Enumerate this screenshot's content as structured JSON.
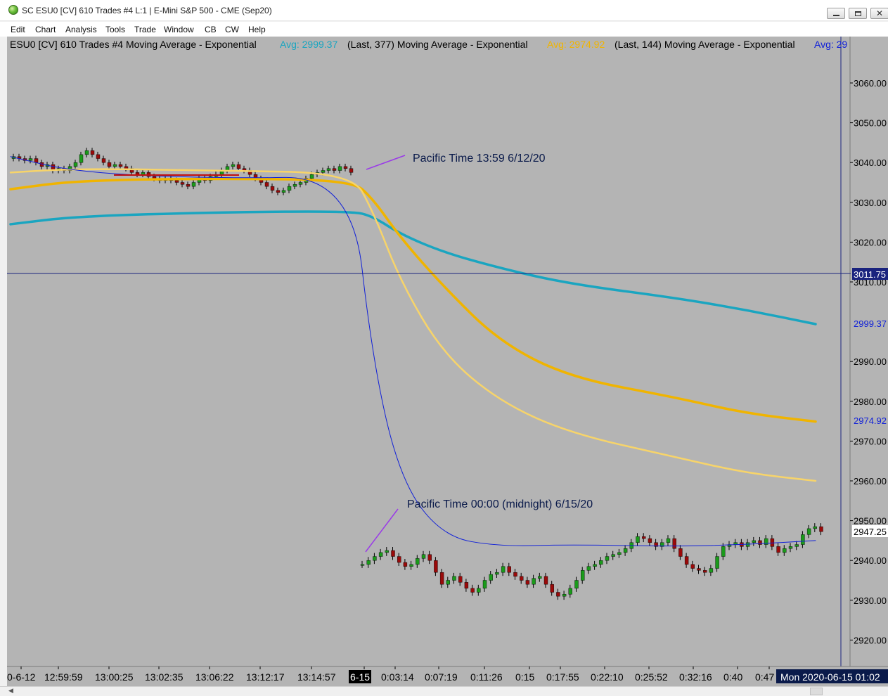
{
  "window": {
    "title": "SC ESU0 [CV]  610 Trades  #4  L:1 | E-Mini S&P 500 - CME (Sep20)",
    "controls": [
      "minimize",
      "restore",
      "close"
    ]
  },
  "menu": {
    "items": [
      "Edit",
      "Chart",
      "Analysis",
      "Tools",
      "Trade",
      "Window",
      "CB",
      "CW",
      "Help"
    ]
  },
  "study_header": {
    "prefix": "ESU0 [CV]  610 Trades  #4 Moving Average - Exponential",
    "study1_avg": "Avg: 2999.37",
    "study1_params": "(Last, 377)  Moving Average - Exponential",
    "study2_avg": "Avg: 2974.92",
    "study2_params": "(Last, 144)  Moving Average - Exponential",
    "study3_avg": "Avg: 29"
  },
  "annotations": [
    {
      "label": "Pacific Time 13:59 6/12/20"
    },
    {
      "label": "Pacific Time 00:00 (midnight) 6/15/20"
    }
  ],
  "price_axis": {
    "ticks": [
      "3060.00",
      "3050.00",
      "3040.00",
      "3030.00",
      "3020.00",
      "3010.00",
      "2990.00",
      "2980.00",
      "2970.00",
      "2960.00",
      "2950.00",
      "2940.00",
      "2930.00",
      "2920.00"
    ],
    "crosshair_label": "3011.75",
    "last_price_label": "2947.25",
    "ema377_label": "2999.37",
    "ema144_label": "2974.92"
  },
  "time_axis": {
    "labels": [
      "0-6-12",
      "12:59:59",
      "13:00:25",
      "13:02:35",
      "13:06:22",
      "13:12:17",
      "13:14:57",
      "6-15",
      "0:03:14",
      "0:07:19",
      "0:11:26",
      "0:15",
      "0:17:55",
      "0:22:10",
      "0:25:52",
      "0:32:16",
      "0:40",
      "0:47"
    ],
    "cursor_label": "Mon 2020-06-15  01:02"
  },
  "colors": {
    "chart_bg": "#b4b4b4",
    "ema377": "#1aa5c0",
    "ema144": "#f0b400",
    "ema_fast_yellow": "#f7d46a",
    "ema_blue": "#1020d8",
    "red_line": "#c01010",
    "annotation_line": "#9a3ae8",
    "crosshair": "#1a237e",
    "candle_up": "#1a9a1a",
    "candle_down": "#9a0a0a"
  },
  "chart_data": {
    "type": "line",
    "ylim": [
      2915,
      3070
    ],
    "series": [
      {
        "values": [
          3024.5,
          3026.5,
          3027.5,
          3027.8,
          3026.5,
          3022,
          3017.5,
          3013.5,
          3009.5,
          3006,
          3003,
          2999.4
        ]
      },
      {
        "values": [
          3033.3,
          3035.5,
          3036,
          3035.6,
          3031,
          3021,
          3009,
          2995,
          2986,
          2981,
          2977,
          2974.9
        ]
      },
      {
        "values": [
          3037.5,
          3038.5,
          3038,
          3037.4,
          3028,
          3010,
          2992,
          2980,
          2972,
          2966,
          2962,
          2960
        ]
      },
      {
        "values": [
          3041.5,
          3037.5,
          3036,
          3036.5,
          2990,
          2960,
          2946,
          2943.5,
          2944,
          2943.5,
          2944,
          2945
        ]
      }
    ]
  }
}
